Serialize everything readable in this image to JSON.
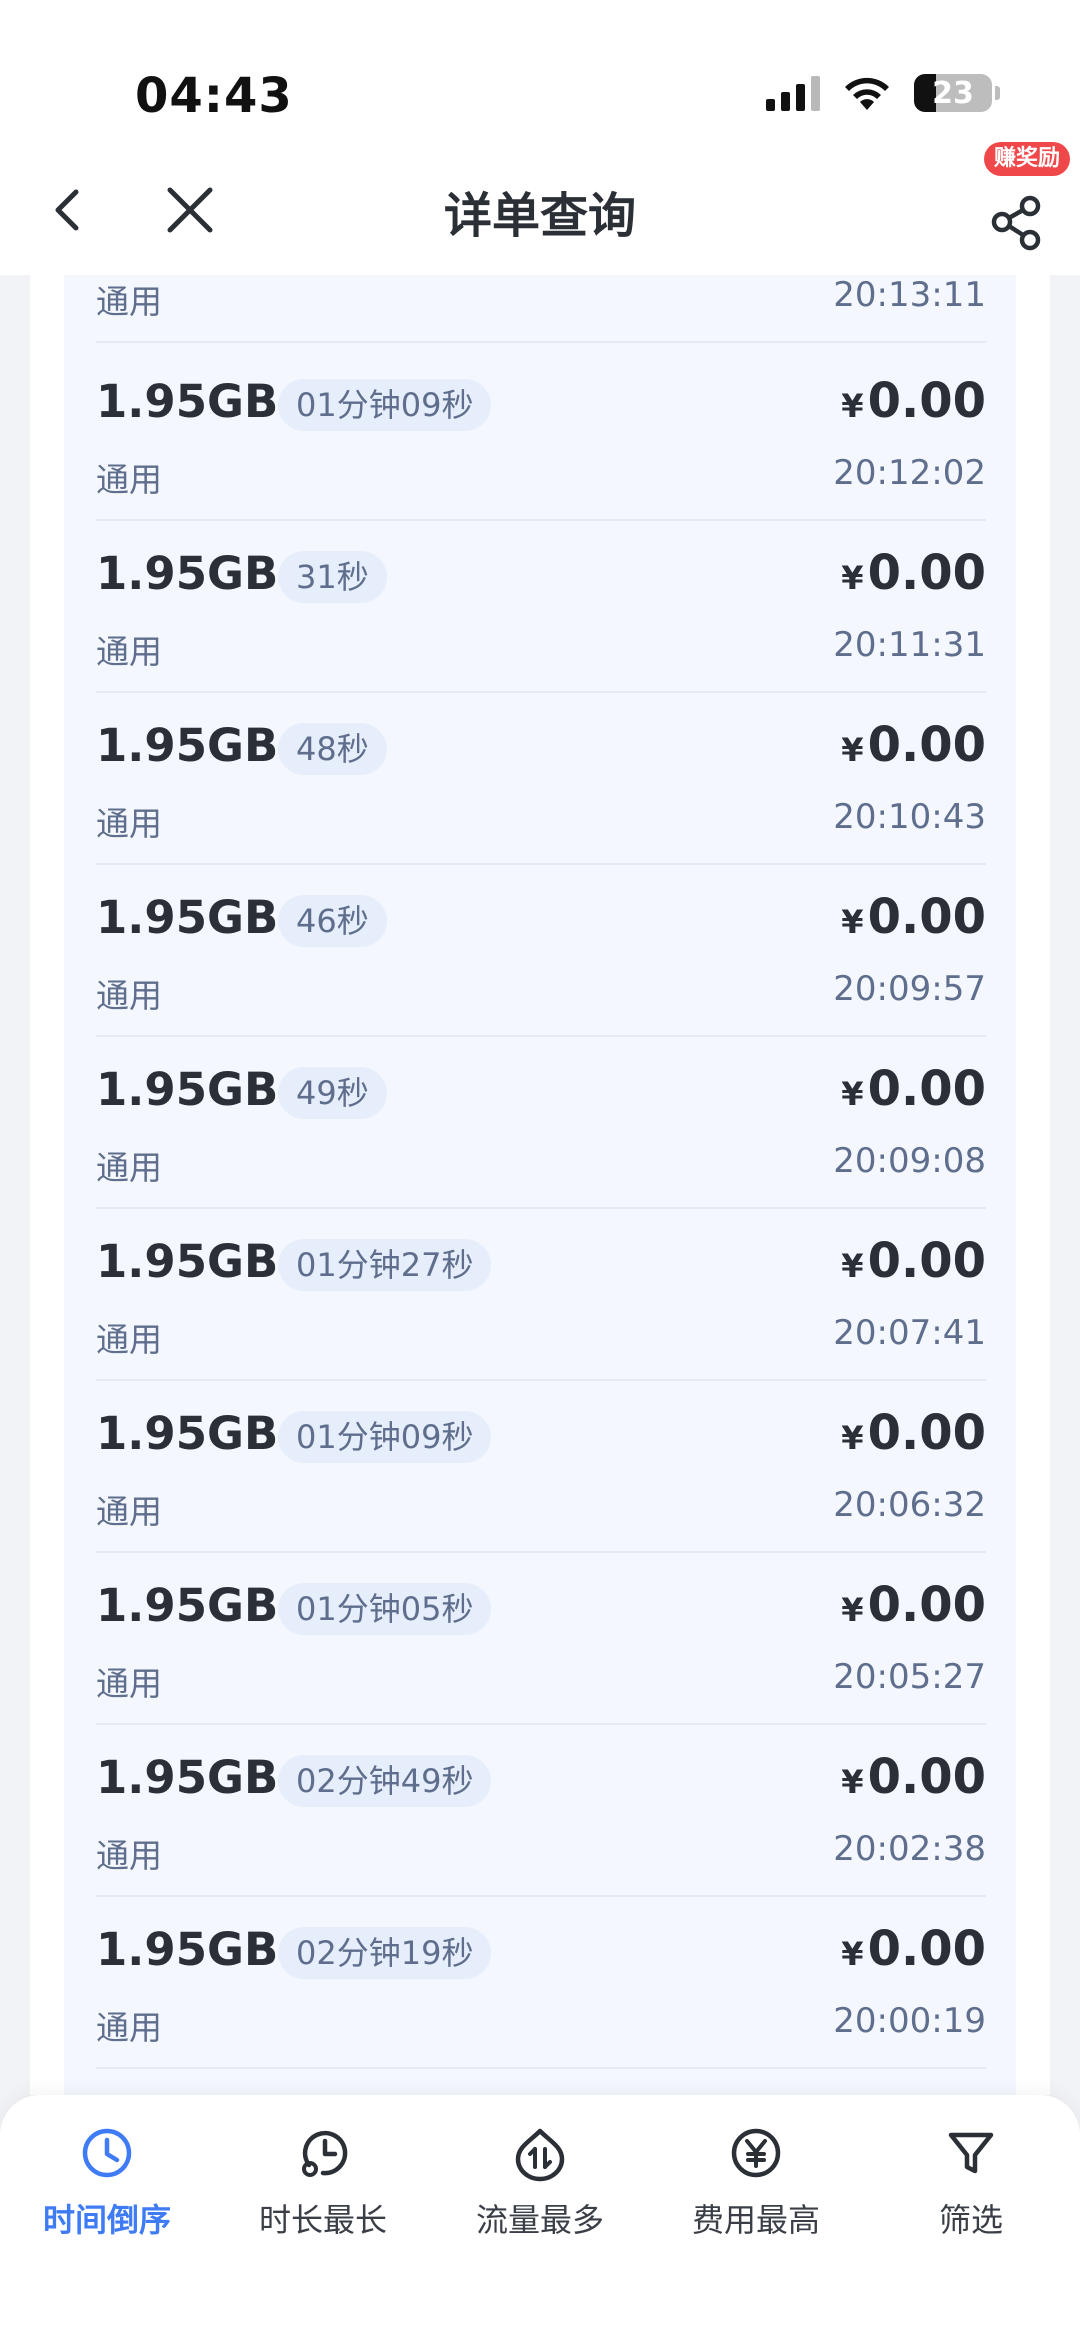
{
  "status_bar": {
    "time": "04:43",
    "battery": "23"
  },
  "header": {
    "title": "详单查询",
    "reward_badge": "赚奖励"
  },
  "records_partial_top": {
    "type": "通用",
    "time": "20:13:11"
  },
  "records": [
    {
      "amount": "1.95GB",
      "duration": "01分钟09秒",
      "type": "通用",
      "currency": "¥",
      "fee": "0.00",
      "time": "20:12:02"
    },
    {
      "amount": "1.95GB",
      "duration": "31秒",
      "type": "通用",
      "currency": "¥",
      "fee": "0.00",
      "time": "20:11:31"
    },
    {
      "amount": "1.95GB",
      "duration": "48秒",
      "type": "通用",
      "currency": "¥",
      "fee": "0.00",
      "time": "20:10:43"
    },
    {
      "amount": "1.95GB",
      "duration": "46秒",
      "type": "通用",
      "currency": "¥",
      "fee": "0.00",
      "time": "20:09:57"
    },
    {
      "amount": "1.95GB",
      "duration": "49秒",
      "type": "通用",
      "currency": "¥",
      "fee": "0.00",
      "time": "20:09:08"
    },
    {
      "amount": "1.95GB",
      "duration": "01分钟27秒",
      "type": "通用",
      "currency": "¥",
      "fee": "0.00",
      "time": "20:07:41"
    },
    {
      "amount": "1.95GB",
      "duration": "01分钟09秒",
      "type": "通用",
      "currency": "¥",
      "fee": "0.00",
      "time": "20:06:32"
    },
    {
      "amount": "1.95GB",
      "duration": "01分钟05秒",
      "type": "通用",
      "currency": "¥",
      "fee": "0.00",
      "time": "20:05:27"
    },
    {
      "amount": "1.95GB",
      "duration": "02分钟49秒",
      "type": "通用",
      "currency": "¥",
      "fee": "0.00",
      "time": "20:02:38"
    },
    {
      "amount": "1.95GB",
      "duration": "02分钟19秒",
      "type": "通用",
      "currency": "¥",
      "fee": "0.00",
      "time": "20:00:19"
    }
  ],
  "tabs": [
    {
      "label": "时间倒序",
      "icon": "clock-icon",
      "active": true
    },
    {
      "label": "时长最长",
      "icon": "duration-icon",
      "active": false
    },
    {
      "label": "流量最多",
      "icon": "traffic-icon",
      "active": false
    },
    {
      "label": "费用最高",
      "icon": "yuan-icon",
      "active": false
    },
    {
      "label": "筛选",
      "icon": "filter-icon",
      "active": false
    }
  ],
  "colors": {
    "accent": "#3e7bf4",
    "badge": "#f0484a",
    "list_bg": "#f4f8fe",
    "pill_bg": "#e6eefb"
  }
}
